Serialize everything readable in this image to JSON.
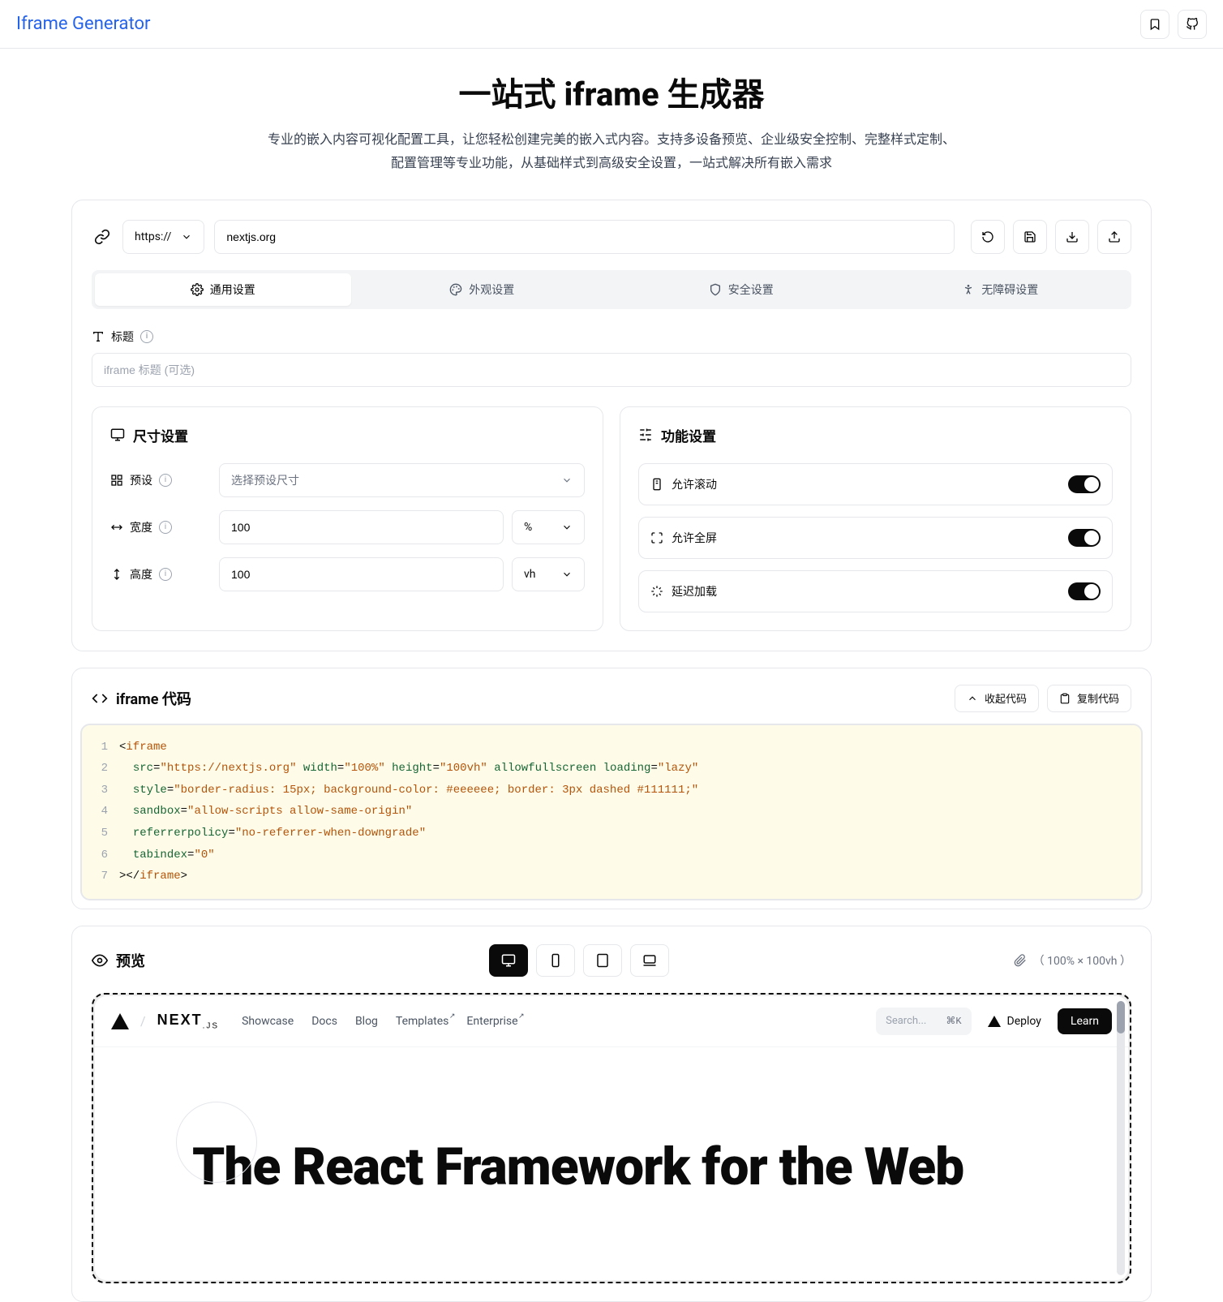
{
  "brand": "Iframe Generator",
  "hero": {
    "title": "一站式 iframe 生成器",
    "subtitle": "专业的嵌入内容可视化配置工具，让您轻松创建完美的嵌入式内容。支持多设备预览、企业级安全控制、完整样式定制、配置管理等专业功能，从基础样式到高级安全设置，一站式解决所有嵌入需求"
  },
  "url": {
    "protocol": "https://",
    "value": "nextjs.org"
  },
  "tabs": {
    "general": "通用设置",
    "appearance": "外观设置",
    "security": "安全设置",
    "accessibility": "无障碍设置"
  },
  "title_field": {
    "label": "标题",
    "placeholder": "iframe 标题 (可选)"
  },
  "dimensions": {
    "heading": "尺寸设置",
    "preset_label": "预设",
    "preset_placeholder": "选择预设尺寸",
    "width_label": "宽度",
    "width_value": "100",
    "width_unit": "%",
    "height_label": "高度",
    "height_value": "100",
    "height_unit": "vh"
  },
  "features": {
    "heading": "功能设置",
    "scroll": "允许滚动",
    "fullscreen": "允许全屏",
    "lazy": "延迟加载"
  },
  "code": {
    "heading": "iframe 代码",
    "collapse": "收起代码",
    "copy": "复制代码",
    "lines": {
      "src_url": "https://nextjs.org",
      "width": "100%",
      "height": "100vh",
      "style": "border-radius: 15px; background-color: #eeeeee; border: 3px dashed #111111;",
      "sandbox": "allow-scripts allow-same-origin",
      "referrer": "no-referrer-when-downgrade",
      "tabindex": "0"
    }
  },
  "preview": {
    "heading": "预览",
    "size_text": "（ 100% × 100vh ）"
  },
  "mock": {
    "brand_next": "NEXT",
    "brand_js": ".JS",
    "nav": {
      "showcase": "Showcase",
      "docs": "Docs",
      "blog": "Blog",
      "templates": "Templates",
      "enterprise": "Enterprise"
    },
    "search_placeholder": "Search...",
    "search_kbd": "⌘K",
    "deploy": "Deploy",
    "learn": "Learn",
    "hero": "The React Framework for the Web"
  }
}
